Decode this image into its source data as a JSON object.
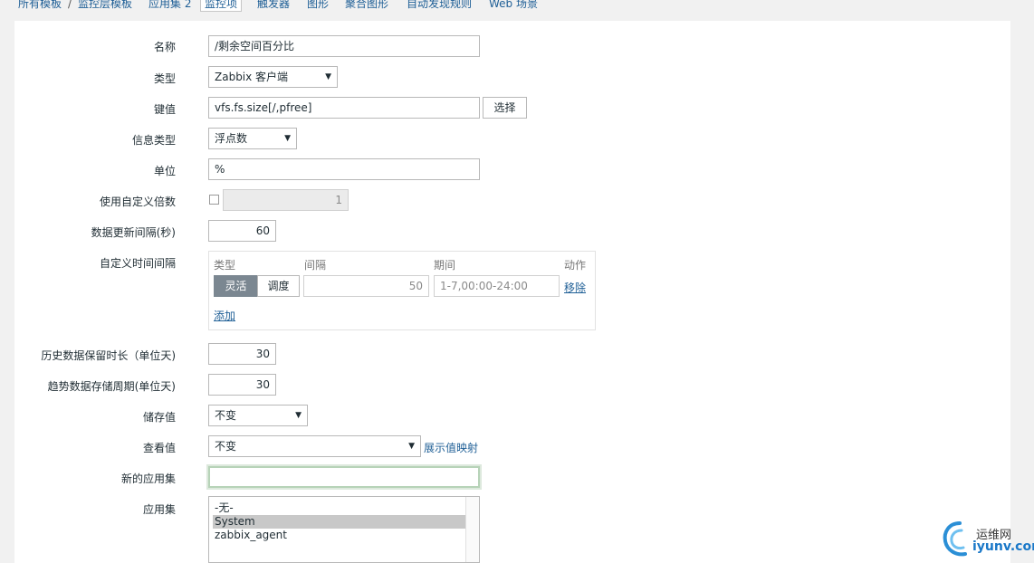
{
  "tabs": [
    "所有模板",
    "/",
    "监控层模板",
    "应用集 2",
    "监控项",
    "触发器",
    "图形",
    "聚合图形",
    "自动发现规则",
    "Web 场景"
  ],
  "form": {
    "name": {
      "label": "名称",
      "value": "/剩余空间百分比"
    },
    "type": {
      "label": "类型",
      "value": "Zabbix 客户端"
    },
    "key": {
      "label": "键值",
      "value": "vfs.fs.size[/,pfree]",
      "button": "选择"
    },
    "info_type": {
      "label": "信息类型",
      "value": "浮点数"
    },
    "unit": {
      "label": "单位",
      "value": "%"
    },
    "multiplier": {
      "label": "使用自定义倍数",
      "value": "1"
    },
    "update_interval": {
      "label": "数据更新间隔(秒)",
      "value": "60"
    },
    "custom_intervals": {
      "label": "自定义时间间隔",
      "headers": {
        "type": "类型",
        "interval": "间隔",
        "period": "期间",
        "action": "动作"
      },
      "flexible_label": "灵活",
      "scheduling_label": "调度",
      "interval_value": "50",
      "period_placeholder": "1-7,00:00-24:00",
      "remove_label": "移除",
      "add_label": "添加"
    },
    "history": {
      "label": "历史数据保留时长（单位天)",
      "value": "30"
    },
    "trends": {
      "label": "趋势数据存储周期(单位天)",
      "value": "30"
    },
    "store_value": {
      "label": "储存值",
      "value": "不变"
    },
    "show_value": {
      "label": "查看值",
      "value": "不变",
      "link": "展示值映射"
    },
    "new_application": {
      "label": "新的应用集",
      "value": ""
    },
    "applications": {
      "label": "应用集",
      "options": [
        "-无-",
        "System",
        "zabbix_agent"
      ]
    }
  },
  "watermark": {
    "line1": "运维网",
    "line2": "iyunv.com"
  }
}
